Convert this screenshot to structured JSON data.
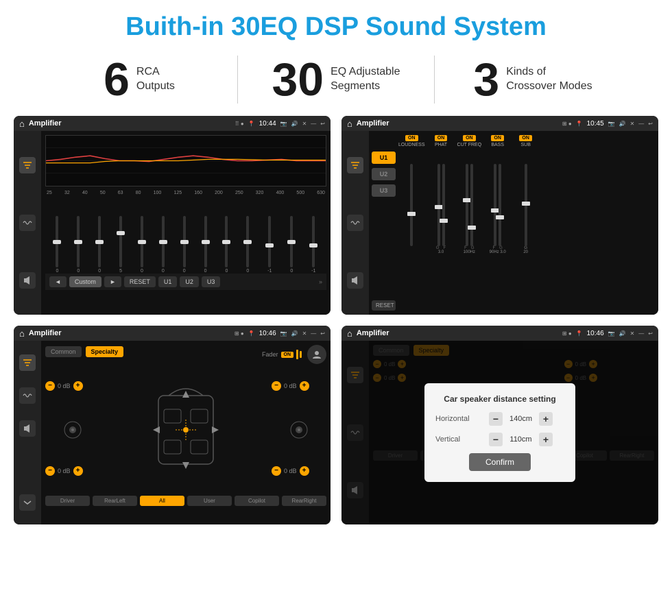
{
  "title": "Buith-in 30EQ DSP Sound System",
  "stats": [
    {
      "number": "6",
      "label": "RCA\nOutputs"
    },
    {
      "number": "30",
      "label": "EQ Adjustable\nSegments"
    },
    {
      "number": "3",
      "label": "Kinds of\nCrossover Modes"
    }
  ],
  "screens": [
    {
      "id": "eq-screen",
      "statusBar": {
        "appTitle": "Amplifier",
        "time": "10:44"
      },
      "type": "eq"
    },
    {
      "id": "amp-screen",
      "statusBar": {
        "appTitle": "Amplifier",
        "time": "10:45"
      },
      "type": "amp"
    },
    {
      "id": "fader-screen",
      "statusBar": {
        "appTitle": "Amplifier",
        "time": "10:46"
      },
      "type": "fader"
    },
    {
      "id": "dialog-screen",
      "statusBar": {
        "appTitle": "Amplifier",
        "time": "10:46"
      },
      "type": "dialog"
    }
  ],
  "eq": {
    "freqLabels": [
      "25",
      "32",
      "40",
      "50",
      "63",
      "80",
      "100",
      "125",
      "160",
      "200",
      "250",
      "320",
      "400",
      "500",
      "630"
    ],
    "bottomButtons": [
      "◄",
      "Custom",
      "►",
      "RESET",
      "U1",
      "U2",
      "U3"
    ],
    "sliderValues": [
      "0",
      "0",
      "0",
      "5",
      "0",
      "0",
      "0",
      "0",
      "0",
      "0",
      "-1",
      "0",
      "-1"
    ]
  },
  "amp": {
    "presets": [
      "U1",
      "U2",
      "U3"
    ],
    "channels": [
      {
        "label": "LOUDNESS",
        "on": true
      },
      {
        "label": "PHAT",
        "on": true
      },
      {
        "label": "CUT FREQ",
        "on": true
      },
      {
        "label": "BASS",
        "on": true
      },
      {
        "label": "SUB",
        "on": true
      }
    ],
    "resetLabel": "RESET"
  },
  "fader": {
    "tabs": [
      "Common",
      "Specialty"
    ],
    "faderLabel": "Fader",
    "onLabel": "ON",
    "dbValues": [
      "0 dB",
      "0 dB",
      "0 dB",
      "0 dB"
    ],
    "bottomButtons": [
      "Driver",
      "RearLeft",
      "All",
      "User",
      "Copilot",
      "RearRight"
    ]
  },
  "dialog": {
    "title": "Car speaker distance setting",
    "horizontal": {
      "label": "Horizontal",
      "value": "140cm"
    },
    "vertical": {
      "label": "Vertical",
      "value": "110cm"
    },
    "confirmLabel": "Confirm"
  }
}
